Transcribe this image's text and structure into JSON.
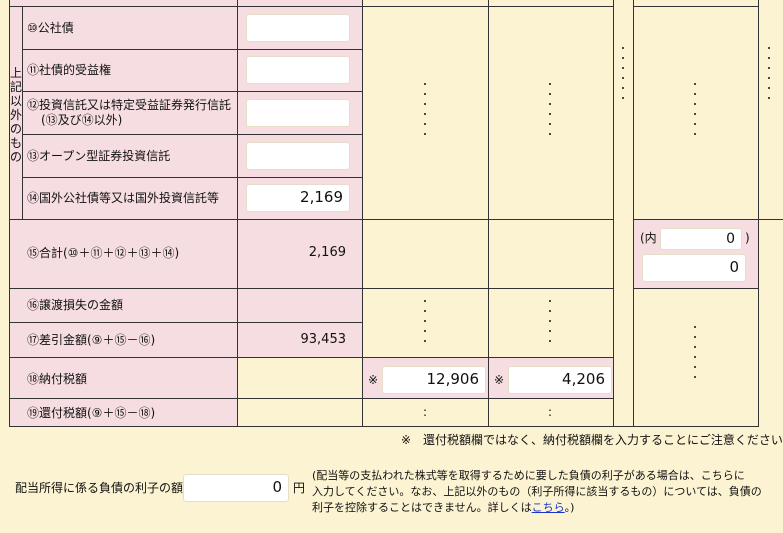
{
  "group_label": "上記以外のもの",
  "rows": {
    "r10": {
      "label": "⑩公社債",
      "value": ""
    },
    "r11": {
      "label": "⑪社債的受益権",
      "value": ""
    },
    "r12": {
      "label1": "⑫投資信託又は特定受益証券発行信託",
      "label2": "(⑬及び⑭以外)",
      "value": ""
    },
    "r13": {
      "label": "⑬オープン型証券投資信託",
      "value": ""
    },
    "r14": {
      "label": "⑭国外公社債等又は国外投資信託等",
      "value": "2,169"
    },
    "r15": {
      "label": "⑮合計(⑩＋⑪＋⑫＋⑬＋⑭)",
      "value": "2,169",
      "inner_prefix": "(内",
      "inner_value": "0",
      "inner_suffix": ")",
      "total_value": "0"
    },
    "r16": {
      "label": "⑯譲渡損失の金額"
    },
    "r17": {
      "label": "⑰差引金額(⑨＋⑮－⑯)",
      "value": "93,453"
    },
    "r18": {
      "label": "⑱納付税額",
      "mark": "※",
      "value1": "12,906",
      "value2": "4,206"
    },
    "r19": {
      "label": "⑲還付税額(⑨＋⑮－⑱)",
      "colon": ":"
    }
  },
  "note": "※　還付税額欄ではなく、納付税額欄を入力することにご注意ください。",
  "interest": {
    "label": "配当所得に係る負債の利子の額",
    "value": "0",
    "unit": "円",
    "desc1": "(配当等の支払われた株式等を取得するために要した負債の利子がある場合は、こちらに",
    "desc2": "入力してください。なお、上記以外のもの（利子所得に該当するもの）については、負債の",
    "desc3": "利子を控除することはできません。詳しくは",
    "link": "こちら",
    "desc_end": "。)"
  }
}
